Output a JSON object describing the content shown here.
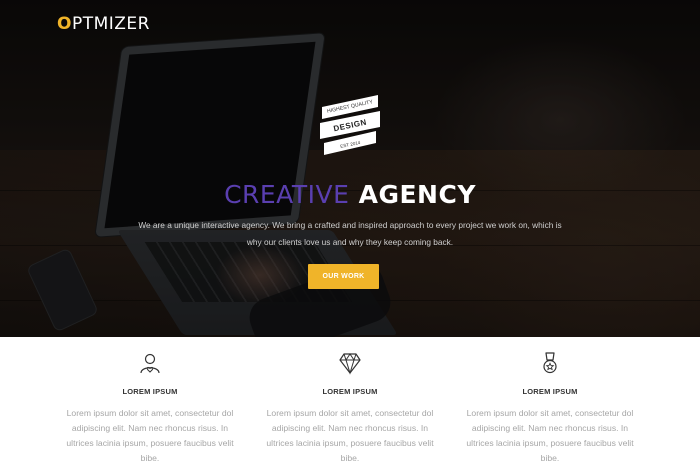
{
  "brand": {
    "logo_first": "O",
    "logo_rest": "PTMIZER",
    "accent": "#f0b429"
  },
  "badge": {
    "top": "HIGHEST QUALITY",
    "middle": "DESIGN",
    "bottom": "EST 2014"
  },
  "hero": {
    "headline_part1": "CREATIVE",
    "headline_part2": "AGENCY",
    "headline_part1_color": "#5a3fb0",
    "subtitle": "We are a unique interactive agency. We bring a crafted and inspired approach to every project we work on, which is why our clients love us and why they keep coming back.",
    "cta_label": "OUR WORK"
  },
  "features": [
    {
      "icon": "user-heart-icon",
      "title": "LOREM IPSUM",
      "text": "Lorem ipsum dolor sit amet, consectetur dol adipiscing elit. Nam nec rhoncus risus. In ultrices lacinia ipsum, posuere faucibus velit bibe."
    },
    {
      "icon": "diamond-icon",
      "title": "LOREM IPSUM",
      "text": "Lorem ipsum dolor sit amet, consectetur dol adipiscing elit. Nam nec rhoncus risus. In ultrices lacinia ipsum, posuere faucibus velit bibe."
    },
    {
      "icon": "medal-icon",
      "title": "LOREM IPSUM",
      "text": "Lorem ipsum dolor sit amet, consectetur dol adipiscing elit. Nam nec rhoncus risus. In ultrices lacinia ipsum, posuere faucibus velit bibe."
    }
  ]
}
